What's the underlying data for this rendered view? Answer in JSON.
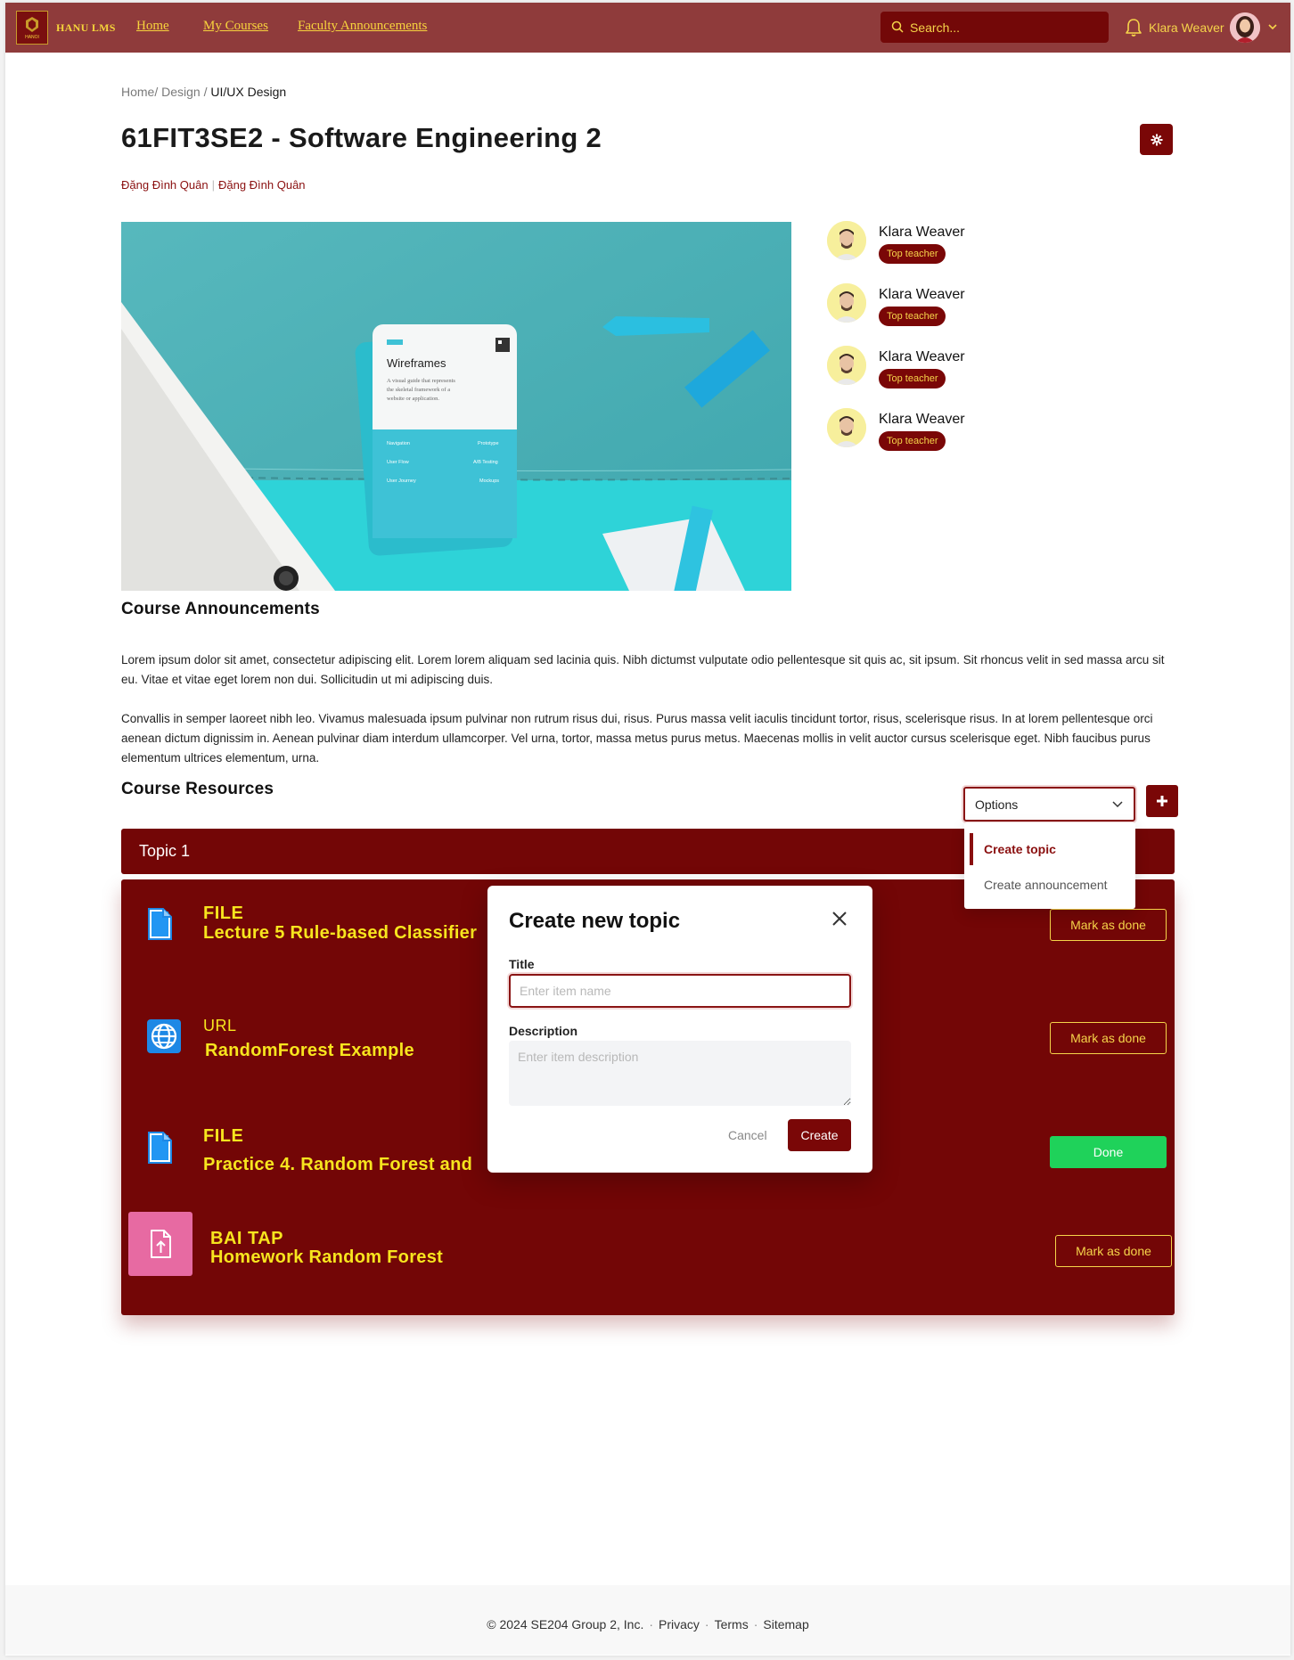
{
  "nav": {
    "brand": "HANU LMS",
    "logo_text": "HANOI",
    "links": [
      "Home",
      "My Courses",
      "Faculty Announcements"
    ],
    "search_placeholder": "Search...",
    "user_name": "Klara Weaver"
  },
  "breadcrumb": {
    "items": [
      "Home/",
      "Design /"
    ],
    "current": "UI/UX Design"
  },
  "course": {
    "title": "61FIT3SE2 - Software Engineering 2",
    "teachers": [
      "Đặng Đình Quân",
      "Đặng Đình Quân"
    ],
    "image_card": {
      "title": "Wireframes",
      "desc": "A visual guide that represents the skeletal framework of a website or application."
    }
  },
  "top_teachers": [
    {
      "name": "Klara Weaver",
      "badge": "Top teacher"
    },
    {
      "name": "Klara Weaver",
      "badge": "Top teacher"
    },
    {
      "name": "Klara Weaver",
      "badge": "Top teacher"
    },
    {
      "name": "Klara Weaver",
      "badge": "Top teacher"
    }
  ],
  "announcements": {
    "heading": "Course Announcements",
    "paragraphs": [
      "Lorem ipsum dolor sit amet, consectetur adipiscing elit. Lorem lorem aliquam sed lacinia quis. Nibh dictumst vulputate odio pellentesque sit quis ac, sit ipsum. Sit rhoncus velit in sed massa arcu sit eu. Vitae et vitae eget lorem non dui. Sollicitudin ut mi adipiscing duis.",
      "Convallis in semper laoreet nibh leo. Vivamus malesuada ipsum pulvinar non rutrum risus dui, risus. Purus massa velit iaculis tincidunt tortor, risus, scelerisque risus. In at lorem pellentesque orci aenean dictum dignissim in. Aenean pulvinar diam interdum ullamcorper. Vel urna, tortor, massa metus purus metus. Maecenas mollis in velit auctor cursus scelerisque eget. Nibh faucibus purus elementum ultrices elementum, urna."
    ]
  },
  "resources": {
    "heading": "Course Resources",
    "options_label": "Options",
    "menu": [
      "Create topic",
      "Create announcement"
    ],
    "topic": "Topic 1",
    "items": [
      {
        "type": "FILE",
        "title": "Lecture 5 Rule-based Classifier",
        "button": "Mark as done"
      },
      {
        "type": "URL",
        "title": "RandomForest Example",
        "button": "Mark as done"
      },
      {
        "type": "FILE",
        "title": "Practice 4. Random Forest and",
        "button": "Done"
      },
      {
        "type": "BAI TAP",
        "title": "Homework Random Forest",
        "button": "Mark as done"
      }
    ]
  },
  "modal": {
    "title": "Create new topic",
    "title_label": "Title",
    "title_placeholder": "Enter item name",
    "desc_label": "Description",
    "desc_placeholder": "Enter item description",
    "cancel": "Cancel",
    "create": "Create"
  },
  "footer": {
    "copyright": "© 2024 SE204 Group 2, Inc.",
    "links": [
      "Privacy",
      "Terms",
      "Sitemap"
    ]
  },
  "colors": {
    "nav_bg": "#8f3b3b",
    "brand_dark": "#730606",
    "accent_yellow": "#f7e51e",
    "done_green": "#1fd25a"
  }
}
